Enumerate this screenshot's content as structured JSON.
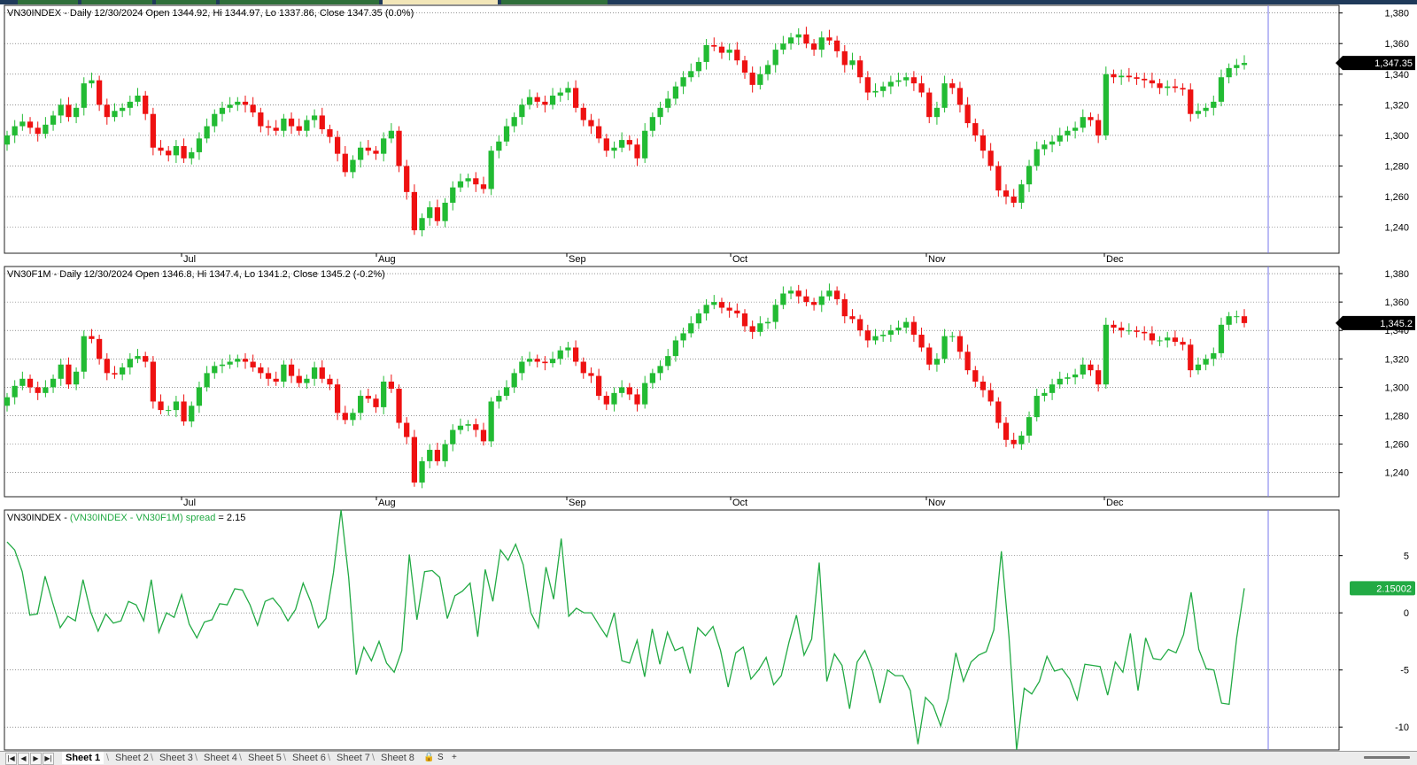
{
  "headers": {
    "pane1": "VN30INDEX - Daily 12/30/2024 Open 1344.92, Hi 1344.97, Lo 1337.86, Close 1347.35 (0.0%)",
    "pane2": "VN30F1M - Daily 12/30/2024 Open 1346.8, Hi 1347.4, Lo 1341.2, Close 1345.2 (-0.2%)",
    "pane3_name": "VN30INDEX - ",
    "pane3_formula": "(VN30INDEX - VN30F1M) spread",
    "pane3_value": " = 2.15"
  },
  "last_value_tags": {
    "pane1": "1,347.35",
    "pane2": "1,345.2",
    "pane3": "2.15002"
  },
  "colors": {
    "up": "#22bb33",
    "down": "#ee1111",
    "spread_line": "#22aa44",
    "cursor": "#7777ee",
    "grid": "#555555",
    "tag_bg": "#000000",
    "tag_text": "#ffffff",
    "spread_tag_bg": "#22aa44"
  },
  "status_bar": {
    "sheets": [
      "Sheet 1",
      "Sheet 2",
      "Sheet 3",
      "Sheet 4",
      "Sheet 5",
      "Sheet 6",
      "Sheet 7",
      "Sheet 8"
    ],
    "active_sheet": "Sheet 1",
    "nav_buttons": [
      "|◀",
      "◀",
      "▶",
      "▶|"
    ],
    "tail_text": "S"
  },
  "chart_data": [
    {
      "type": "candlestick",
      "name": "VN30INDEX",
      "x_month_labels": [
        "Jul",
        "Aug",
        "Sep",
        "Oct",
        "Nov",
        "Dec"
      ],
      "y_ticks": [
        1240,
        1260,
        1280,
        1300,
        1320,
        1340,
        1360,
        1380
      ],
      "ylim": [
        1223,
        1385
      ],
      "grid": true,
      "closes": [
        1300,
        1306,
        1309,
        1305,
        1301,
        1307,
        1313,
        1320,
        1312,
        1318,
        1334,
        1336,
        1320,
        1312,
        1316,
        1318,
        1322,
        1326,
        1314,
        1292,
        1290,
        1287,
        1293,
        1285,
        1289,
        1298,
        1306,
        1314,
        1318,
        1320,
        1322,
        1320,
        1315,
        1306,
        1305,
        1303,
        1311,
        1306,
        1303,
        1310,
        1313,
        1304,
        1299,
        1288,
        1276,
        1284,
        1292,
        1290,
        1288,
        1298,
        1303,
        1280,
        1263,
        1238,
        1246,
        1253,
        1244,
        1256,
        1266,
        1270,
        1272,
        1268,
        1265,
        1290,
        1296,
        1306,
        1312,
        1320,
        1325,
        1322,
        1320,
        1326,
        1328,
        1331,
        1318,
        1310,
        1306,
        1298,
        1290,
        1292,
        1297,
        1294,
        1285,
        1303,
        1312,
        1318,
        1324,
        1332,
        1338,
        1342,
        1348,
        1359,
        1358,
        1354,
        1356,
        1349,
        1341,
        1333,
        1340,
        1346,
        1356,
        1360,
        1364,
        1366,
        1360,
        1356,
        1364,
        1362,
        1355,
        1346,
        1349,
        1338,
        1328,
        1329,
        1332,
        1335,
        1336,
        1338,
        1334,
        1328,
        1312,
        1318,
        1334,
        1331,
        1320,
        1308,
        1300,
        1290,
        1280,
        1264,
        1260,
        1256,
        1268,
        1280,
        1291,
        1294,
        1296,
        1300,
        1303,
        1305,
        1312,
        1310,
        1300,
        1340,
        1338,
        1339,
        1338,
        1337,
        1336,
        1334,
        1331,
        1332,
        1331,
        1330,
        1314,
        1316,
        1318,
        1322,
        1338,
        1344,
        1346,
        1347.35
      ],
      "last_value": 1347.35
    },
    {
      "type": "candlestick",
      "name": "VN30F1M",
      "x_month_labels": [
        "Jul",
        "Aug",
        "Sep",
        "Oct",
        "Nov",
        "Dec"
      ],
      "y_ticks": [
        1240,
        1260,
        1280,
        1300,
        1320,
        1340,
        1360,
        1380
      ],
      "ylim": [
        1223,
        1385
      ],
      "grid": true,
      "closes": [
        1293,
        1301,
        1306,
        1300,
        1296,
        1300,
        1306,
        1316,
        1302,
        1311,
        1336,
        1334,
        1320,
        1310,
        1309,
        1314,
        1320,
        1322,
        1318,
        1290,
        1284,
        1284,
        1290,
        1276,
        1287,
        1300,
        1310,
        1315,
        1316,
        1318,
        1320,
        1318,
        1314,
        1310,
        1306,
        1304,
        1316,
        1308,
        1303,
        1306,
        1314,
        1306,
        1302,
        1282,
        1277,
        1282,
        1294,
        1292,
        1286,
        1304,
        1299,
        1275,
        1265,
        1233,
        1248,
        1256,
        1248,
        1260,
        1270,
        1273,
        1274,
        1270,
        1262,
        1290,
        1294,
        1300,
        1310,
        1318,
        1320,
        1318,
        1317,
        1320,
        1326,
        1328,
        1318,
        1310,
        1308,
        1294,
        1288,
        1296,
        1300,
        1295,
        1288,
        1303,
        1310,
        1315,
        1322,
        1333,
        1338,
        1345,
        1352,
        1358,
        1360,
        1356,
        1354,
        1352,
        1343,
        1339,
        1345,
        1346,
        1358,
        1366,
        1368,
        1364,
        1360,
        1358,
        1364,
        1368,
        1362,
        1350,
        1348,
        1340,
        1333,
        1336,
        1337,
        1340,
        1342,
        1346,
        1337,
        1328,
        1316,
        1320,
        1336,
        1336,
        1325,
        1312,
        1304,
        1298,
        1290,
        1275,
        1263,
        1260,
        1266,
        1279,
        1294,
        1296,
        1302,
        1306,
        1307,
        1309,
        1316,
        1312,
        1302,
        1344,
        1342,
        1340,
        1340,
        1339,
        1338,
        1333,
        1333,
        1335,
        1332,
        1330,
        1312,
        1316,
        1320,
        1324,
        1344,
        1350,
        1350,
        1345.2
      ],
      "last_value": 1345.2
    },
    {
      "type": "line",
      "name": "(VN30INDEX - VN30F1M) spread",
      "x_month_labels": [],
      "y_ticks": [
        -10,
        -5,
        0,
        5
      ],
      "ylim": [
        -12,
        9
      ],
      "grid": true,
      "values": [
        6.2,
        5.5,
        3.6,
        -0.2,
        -0.1,
        3.2,
        0.9,
        -1.3,
        -0.3,
        -0.7,
        2.9,
        0.1,
        -1.6,
        -0.1,
        -0.9,
        -0.7,
        1.0,
        0.7,
        -0.7,
        2.9,
        -1.7,
        0.0,
        -0.4,
        1.6,
        -1.0,
        -2.2,
        -0.8,
        -0.6,
        0.8,
        0.7,
        2.1,
        2.0,
        0.7,
        -1.1,
        1.0,
        1.3,
        0.5,
        -0.7,
        0.3,
        2.6,
        1.0,
        -1.3,
        -0.5,
        3.5,
        9.0,
        3.1,
        -5.4,
        -3.0,
        -4.2,
        -2.5,
        -4.4,
        -5.2,
        -3.3,
        5.1,
        -0.6,
        3.6,
        3.7,
        3.1,
        -0.5,
        1.5,
        1.9,
        2.6,
        -2.1,
        3.8,
        1.0,
        5.5,
        4.6,
        6.0,
        4.2,
        0.0,
        -1.3,
        4.0,
        1.2,
        6.5,
        -0.3,
        0.4,
        0.0,
        0.0,
        -1.1,
        -2.1,
        0.0,
        -4.2,
        -4.4,
        -2.4,
        -5.6,
        -1.4,
        -4.5,
        -1.7,
        -3.3,
        -3.0,
        -5.3,
        -1.3,
        -2.0,
        -1.2,
        -3.3,
        -6.5,
        -3.5,
        -3.0,
        -5.8,
        -5.0,
        -3.9,
        -6.3,
        -5.5,
        -2.6,
        -0.2,
        -3.7,
        -2.3,
        4.4,
        -6.0,
        -3.6,
        -4.6,
        -8.4,
        -4.3,
        -3.3,
        -5.0,
        -7.9,
        -5.0,
        -5.5,
        -5.5,
        -6.8,
        -11.5,
        -7.4,
        -8.1,
        -9.9,
        -7.5,
        -3.5,
        -6.0,
        -4.3,
        -3.7,
        -3.4,
        -1.5,
        5.4,
        -2.1,
        -12.0,
        -6.6,
        -7.1,
        -6.0,
        -3.8,
        -5.1,
        -4.9,
        -5.8,
        -7.6,
        -4.5,
        -4.6,
        -4.7,
        -7.2,
        -4.3,
        -5.2,
        -1.8,
        -6.8,
        -2.2,
        -4.0,
        -4.1,
        -3.2,
        -3.5,
        -1.9,
        1.8,
        -3.2,
        -4.9,
        -5.0,
        -7.9,
        -8.0,
        -2.2,
        2.15
      ],
      "last_value": 2.15002
    }
  ]
}
